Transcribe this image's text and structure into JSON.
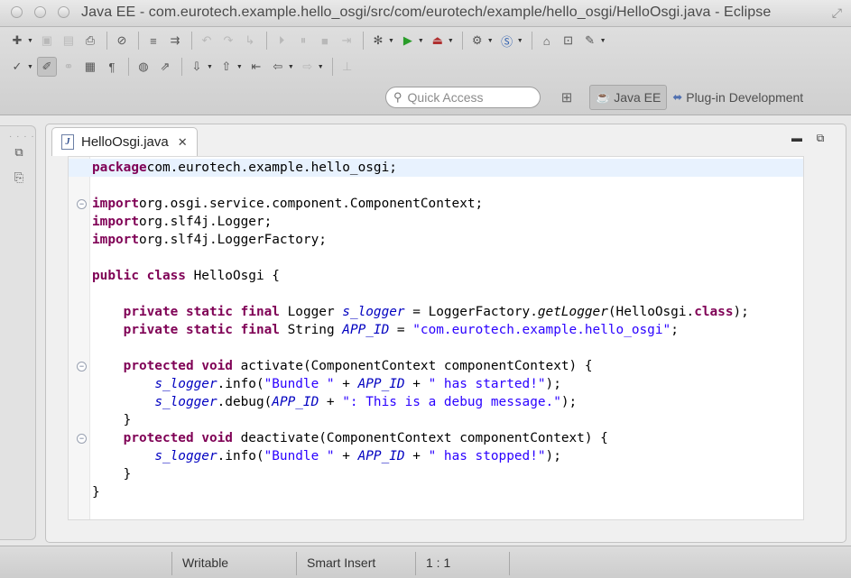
{
  "window": {
    "title": "Java EE - com.eurotech.example.hello_osgi/src/com/eurotech/example/hello_osgi/HelloOsgi.java - Eclipse"
  },
  "toolbar": {
    "row1": [
      {
        "name": "new-icon",
        "glyph": "✚",
        "dd": true
      },
      {
        "name": "save-icon",
        "glyph": "▣",
        "dis": true
      },
      {
        "name": "save-all-icon",
        "glyph": "▤",
        "dis": true
      },
      {
        "name": "print-icon",
        "glyph": "⎙"
      },
      {
        "sep": true
      },
      {
        "name": "toggle-breakpoints-icon",
        "glyph": "⊘"
      },
      {
        "sep": true
      },
      {
        "name": "format-icon",
        "glyph": "≡"
      },
      {
        "name": "publish-icon",
        "glyph": "⇉"
      },
      {
        "sep": true
      },
      {
        "name": "undo-icon",
        "glyph": "↶",
        "dis": true
      },
      {
        "name": "redo-icon",
        "glyph": "↷",
        "dis": true
      },
      {
        "name": "step-icon",
        "glyph": "↳",
        "dis": true
      },
      {
        "sep": true
      },
      {
        "name": "resume-icon",
        "glyph": "⏵",
        "dis": true
      },
      {
        "name": "suspend-icon",
        "glyph": "⏸",
        "dis": true
      },
      {
        "name": "terminate-icon",
        "glyph": "■",
        "dis": true
      },
      {
        "name": "disconnect-icon",
        "glyph": "⇥",
        "dis": true
      },
      {
        "sep": true
      },
      {
        "name": "debug-icon",
        "glyph": "✻",
        "dd": true
      },
      {
        "name": "run-icon",
        "glyph": "▶",
        "dd": true,
        "color": "#2a9d2a"
      },
      {
        "name": "run-external-icon",
        "glyph": "⏏",
        "dd": true,
        "color": "#b03030"
      },
      {
        "sep": true
      },
      {
        "name": "new-server-icon",
        "glyph": "⚙",
        "dd": true
      },
      {
        "name": "new-class-icon",
        "glyph": "Ⓢ",
        "dd": true,
        "color": "#3060b0"
      },
      {
        "sep": true
      },
      {
        "name": "open-folder-icon",
        "glyph": "⌂"
      },
      {
        "name": "open-type-icon",
        "glyph": "⊡"
      },
      {
        "name": "search-tool-icon",
        "glyph": "✎",
        "dd": true
      }
    ],
    "row2": [
      {
        "name": "open-task-icon",
        "glyph": "✓",
        "dd": true
      },
      {
        "name": "mark-occurrences-icon",
        "glyph": "✐",
        "sel": true
      },
      {
        "name": "toggle-block-icon",
        "glyph": "⚭",
        "dis": true
      },
      {
        "name": "show-whitespace-icon",
        "glyph": "▦"
      },
      {
        "name": "paragraph-icon",
        "glyph": "¶"
      },
      {
        "sep": true
      },
      {
        "name": "globe-icon",
        "glyph": "◍"
      },
      {
        "name": "perspective-tool-icon",
        "glyph": "⇗"
      },
      {
        "sep": true
      },
      {
        "name": "next-annotation-icon",
        "glyph": "⇩",
        "dd": true
      },
      {
        "name": "prev-annotation-icon",
        "glyph": "⇧",
        "dd": true
      },
      {
        "name": "last-edit-icon",
        "glyph": "⇤"
      },
      {
        "name": "back-icon",
        "glyph": "⇦",
        "dd": true
      },
      {
        "name": "forward-icon",
        "glyph": "⇨",
        "dd": true,
        "dis": true
      },
      {
        "sep": true
      },
      {
        "name": "pin-editor-icon",
        "glyph": "⊥",
        "dis": true
      }
    ]
  },
  "quick_access": {
    "placeholder": "Quick Access"
  },
  "perspectives": [
    {
      "label": "Java EE",
      "active": true,
      "icon": "java-ee-icon"
    },
    {
      "label": "Plug-in Development",
      "active": false,
      "icon": "plugin-icon"
    }
  ],
  "editor": {
    "tab_label": "HelloOsgi.java",
    "lines": [
      {
        "y": 0,
        "fold": "",
        "current": true,
        "tokens": [
          [
            "kw",
            "package"
          ],
          [
            "",
            "com.eurotech.example.hello_osgi;"
          ]
        ]
      },
      {
        "y": 2,
        "fold": "−",
        "tokens": [
          [
            "kw",
            "import"
          ],
          [
            "",
            "org.osgi.service.component.ComponentContext;"
          ]
        ]
      },
      {
        "y": 3,
        "fold": "",
        "tokens": [
          [
            "kw",
            "import"
          ],
          [
            "",
            "org.slf4j.Logger;"
          ]
        ]
      },
      {
        "y": 4,
        "fold": "",
        "tokens": [
          [
            "kw",
            "import"
          ],
          [
            "",
            "org.slf4j.LoggerFactory;"
          ]
        ]
      },
      {
        "y": 6,
        "fold": "",
        "tokens": [
          [
            "kw",
            "public"
          ],
          [
            "",
            " "
          ],
          [
            "kw",
            "class"
          ],
          [
            "",
            " HelloOsgi {"
          ]
        ]
      },
      {
        "y": 8,
        "fold": "",
        "tokens": [
          [
            "",
            "    "
          ],
          [
            "kw",
            "private"
          ],
          [
            "",
            " "
          ],
          [
            "kw",
            "static"
          ],
          [
            "",
            " "
          ],
          [
            "kw",
            "final"
          ],
          [
            "",
            " Logger "
          ],
          [
            "fld",
            "s_logger"
          ],
          [
            "",
            " = LoggerFactory."
          ],
          [
            "sm",
            "getLogger"
          ],
          [
            "",
            "(HelloOsgi."
          ],
          [
            "kw",
            "class"
          ],
          [
            "",
            ");"
          ]
        ]
      },
      {
        "y": 9,
        "fold": "",
        "tokens": [
          [
            "",
            "    "
          ],
          [
            "kw",
            "private"
          ],
          [
            "",
            " "
          ],
          [
            "kw",
            "static"
          ],
          [
            "",
            " "
          ],
          [
            "kw",
            "final"
          ],
          [
            "",
            " String "
          ],
          [
            "fld",
            "APP_ID"
          ],
          [
            "",
            " = "
          ],
          [
            "str",
            "\"com.eurotech.example.hello_osgi\""
          ],
          [
            "",
            ";"
          ]
        ]
      },
      {
        "y": 11,
        "fold": "−",
        "tokens": [
          [
            "",
            "    "
          ],
          [
            "kw",
            "protected"
          ],
          [
            "",
            " "
          ],
          [
            "kw",
            "void"
          ],
          [
            "",
            " activate(ComponentContext componentContext) {"
          ]
        ]
      },
      {
        "y": 12,
        "fold": "",
        "tokens": [
          [
            "",
            "        "
          ],
          [
            "fld",
            "s_logger"
          ],
          [
            "",
            ".info("
          ],
          [
            "str",
            "\"Bundle \""
          ],
          [
            "",
            " + "
          ],
          [
            "fld",
            "APP_ID"
          ],
          [
            "",
            " + "
          ],
          [
            "str",
            "\" has started!\""
          ],
          [
            "",
            ");"
          ]
        ]
      },
      {
        "y": 13,
        "fold": "",
        "tokens": [
          [
            "",
            "        "
          ],
          [
            "fld",
            "s_logger"
          ],
          [
            "",
            ".debug("
          ],
          [
            "fld",
            "APP_ID"
          ],
          [
            "",
            " + "
          ],
          [
            "str",
            "\": This is a debug message.\""
          ],
          [
            "",
            ");"
          ]
        ]
      },
      {
        "y": 14,
        "fold": "",
        "tokens": [
          [
            "",
            "    }"
          ]
        ]
      },
      {
        "y": 15,
        "fold": "−",
        "tokens": [
          [
            "",
            "    "
          ],
          [
            "kw",
            "protected"
          ],
          [
            "",
            " "
          ],
          [
            "kw",
            "void"
          ],
          [
            "",
            " deactivate(ComponentContext componentContext) {"
          ]
        ]
      },
      {
        "y": 16,
        "fold": "",
        "tokens": [
          [
            "",
            "        "
          ],
          [
            "fld",
            "s_logger"
          ],
          [
            "",
            ".info("
          ],
          [
            "str",
            "\"Bundle \""
          ],
          [
            "",
            " + "
          ],
          [
            "fld",
            "APP_ID"
          ],
          [
            "",
            " + "
          ],
          [
            "str",
            "\" has stopped!\""
          ],
          [
            "",
            ");"
          ]
        ]
      },
      {
        "y": 17,
        "fold": "",
        "tokens": [
          [
            "",
            "    }"
          ]
        ]
      },
      {
        "y": 18,
        "fold": "",
        "tokens": [
          [
            "",
            "}"
          ]
        ]
      }
    ]
  },
  "status": {
    "writable": "Writable",
    "insert_mode": "Smart Insert",
    "position": "1 : 1"
  }
}
